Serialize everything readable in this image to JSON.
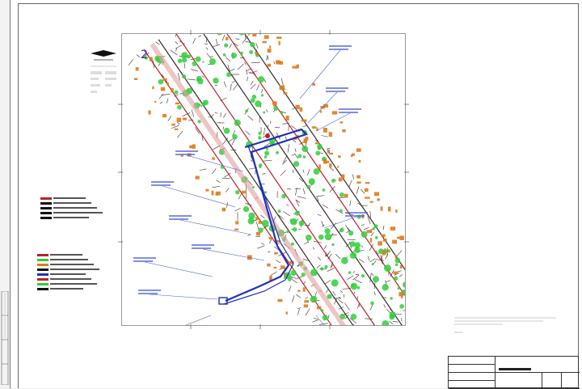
{
  "sheet": {
    "number": "2",
    "notes_text": "",
    "title_block": {
      "rows": [
        "",
        "",
        "",
        ""
      ],
      "name": ""
    }
  },
  "colors": {
    "pipeline_route": "#1f2fbf",
    "vegetation": "#2fcf3a",
    "buildings": "#e07a1a",
    "road_edge": "#c0202a",
    "dense_linework": "#3a2a2a",
    "callout_leader": "#4a5fd8",
    "frame": "#666666"
  },
  "legend": {
    "top_rows": [
      {
        "swatch_color": "#c0202a"
      },
      {
        "swatch_color": "#111111"
      },
      {
        "swatch_color": "#111111"
      },
      {
        "swatch_color": "#111111"
      },
      {
        "swatch_color": "#111111"
      }
    ],
    "bottom_rows": [
      {
        "swatch_color": "#c0202a"
      },
      {
        "swatch_color": "#2fcf3a"
      },
      {
        "swatch_color": "#e07a1a"
      },
      {
        "swatch_color": "#111111"
      },
      {
        "swatch_color": "#1f2fbf"
      },
      {
        "swatch_color": "#c0202a"
      },
      {
        "swatch_color": "#2fcf3a"
      },
      {
        "swatch_color": "#111111"
      }
    ]
  },
  "icons": {
    "north_arrow": "north-arrow-icon",
    "stamp": "side-stamp-icon"
  }
}
